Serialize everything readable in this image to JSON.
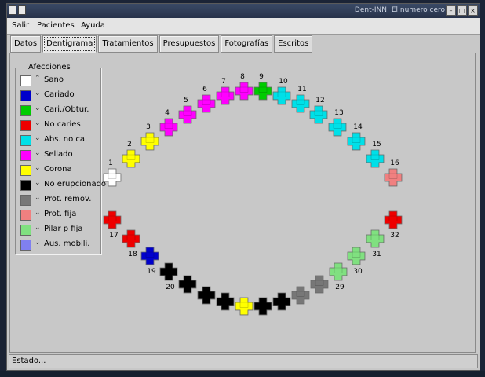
{
  "window": {
    "title": "Dent-INN: El numero cero"
  },
  "menu": {
    "items": [
      "Salir",
      "Pacientes",
      "Ayuda"
    ]
  },
  "tabs": [
    {
      "label": "Datos"
    },
    {
      "label": "Dentigrama"
    },
    {
      "label": "Tratamientos"
    },
    {
      "label": "Presupuestos"
    },
    {
      "label": "Fotografías"
    },
    {
      "label": "Escritos"
    }
  ],
  "active_tab": "Dentigrama",
  "legend": {
    "title": "Afecciones",
    "items": [
      {
        "label": "Sano",
        "color": "#ffffff",
        "arrow": "up"
      },
      {
        "label": "Cariado",
        "color": "#0000cc",
        "arrow": "down"
      },
      {
        "label": "Cari./Obtur.",
        "color": "#00cc00",
        "arrow": "down"
      },
      {
        "label": "No caries",
        "color": "#ee0000",
        "arrow": "down"
      },
      {
        "label": "Abs. no ca.",
        "color": "#00e0e8",
        "arrow": "down"
      },
      {
        "label": "Sellado",
        "color": "#ff00ff",
        "arrow": "down"
      },
      {
        "label": "Corona",
        "color": "#ffff00",
        "arrow": "down"
      },
      {
        "label": "No erupcionado",
        "color": "#000000",
        "arrow": "down"
      },
      {
        "label": "Prot. remov.",
        "color": "#777777",
        "arrow": "down"
      },
      {
        "label": "Prot. fija",
        "color": "#f08080",
        "arrow": "down"
      },
      {
        "label": "Pilar p fija",
        "color": "#80e080",
        "arrow": "down"
      },
      {
        "label": "Aus. mobili.",
        "color": "#8080f0",
        "arrow": "down"
      }
    ]
  },
  "teeth": [
    {
      "number": "1",
      "color": "#ffffff"
    },
    {
      "number": "2",
      "color": "#ffff00"
    },
    {
      "number": "3",
      "color": "#ffff00"
    },
    {
      "number": "4",
      "color": "#ff00ff"
    },
    {
      "number": "5",
      "color": "#ff00ff"
    },
    {
      "number": "6",
      "color": "#ff00ff"
    },
    {
      "number": "7",
      "color": "#ff00ff"
    },
    {
      "number": "8",
      "color": "#ff00ff"
    },
    {
      "number": "9",
      "color": "#00cc00"
    },
    {
      "number": "10",
      "color": "#00e0e8"
    },
    {
      "number": "11",
      "color": "#00e0e8"
    },
    {
      "number": "12",
      "color": "#00e0e8"
    },
    {
      "number": "13",
      "color": "#00e0e8"
    },
    {
      "number": "14",
      "color": "#00e0e8"
    },
    {
      "number": "15",
      "color": "#00e0e8"
    },
    {
      "number": "16",
      "color": "#f08080"
    },
    {
      "number": "17",
      "color": "#ee0000"
    },
    {
      "number": "18",
      "color": "#ee0000"
    },
    {
      "number": "19",
      "color": "#0000cc"
    },
    {
      "number": "20",
      "color": "#000000"
    },
    {
      "number": "",
      "color": "#000000"
    },
    {
      "number": "",
      "color": "#000000"
    },
    {
      "number": "",
      "color": "#000000"
    },
    {
      "number": "",
      "color": "#ffff00"
    },
    {
      "number": "",
      "color": "#000000"
    },
    {
      "number": "",
      "color": "#000000"
    },
    {
      "number": "",
      "color": "#777777"
    },
    {
      "number": "",
      "color": "#777777"
    },
    {
      "number": "29",
      "color": "#80e080"
    },
    {
      "number": "30",
      "color": "#80e080"
    },
    {
      "number": "31",
      "color": "#80e080"
    },
    {
      "number": "32",
      "color": "#ee0000"
    }
  ],
  "status": {
    "text": "Estado..."
  }
}
